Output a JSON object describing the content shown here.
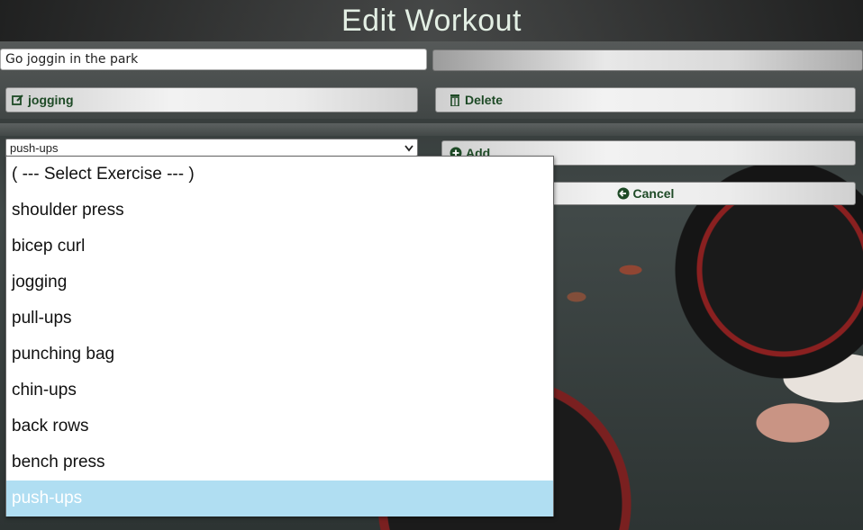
{
  "header": {
    "title": "Edit Workout"
  },
  "form": {
    "workout_name": "Go joggin in the park",
    "exercise_button_label": "jogging",
    "delete_label": "Delete",
    "add_label": "Add",
    "cancel_label": "Cancel"
  },
  "select": {
    "value": "push-ups",
    "options": [
      "( --- Select Exercise --- )",
      "shoulder press",
      "bicep curl",
      "jogging",
      "pull-ups",
      "punching bag",
      "chin-ups",
      "back rows",
      "bench press",
      "push-ups"
    ],
    "selected_index": 9
  },
  "colors": {
    "accent_text": "#1e4a26",
    "selected_option_bg": "#b0def2",
    "title_color": "#e3efe4"
  },
  "icons": {
    "edit": "edit-icon",
    "delete": "trash-icon",
    "add": "plus-circle-icon",
    "cancel": "arrow-left-circle-icon"
  }
}
